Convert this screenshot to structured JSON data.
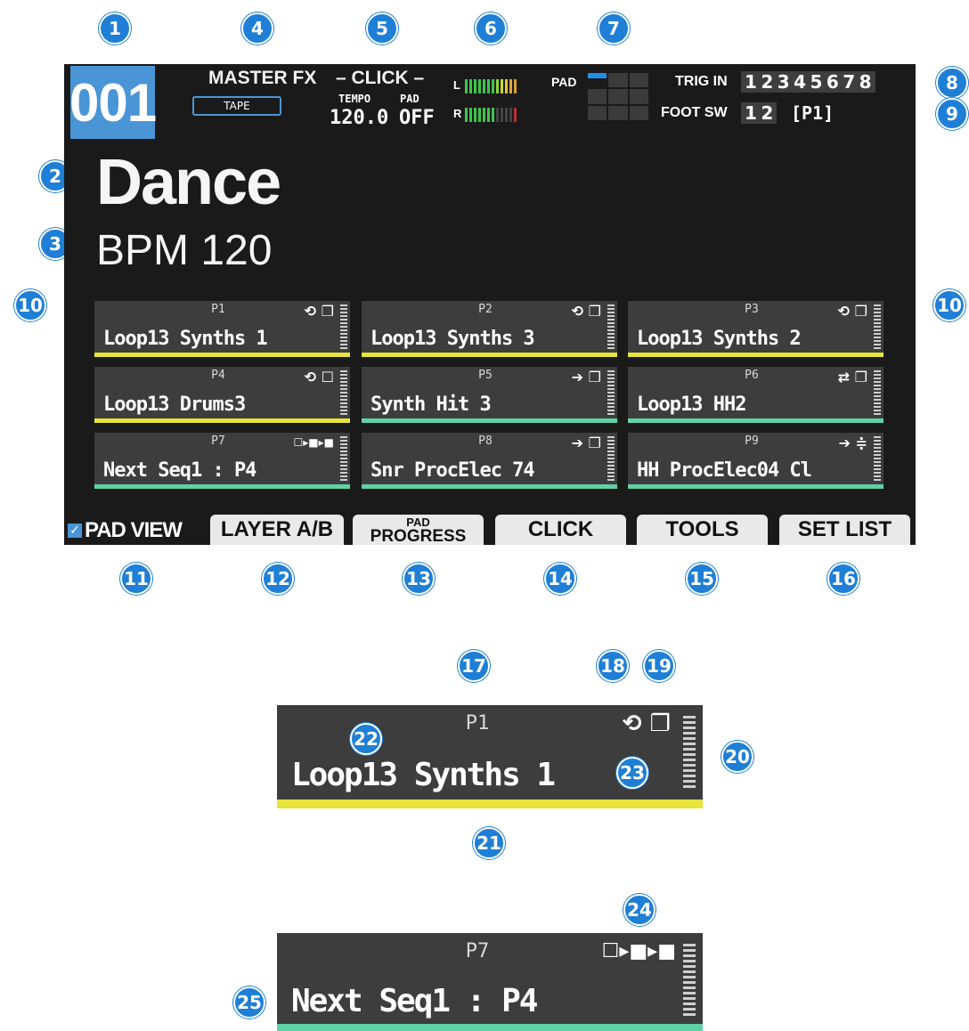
{
  "badges": [
    "1",
    "2",
    "3",
    "4",
    "5",
    "6",
    "7",
    "8",
    "9",
    "10",
    "10",
    "11",
    "12",
    "13",
    "14",
    "15",
    "16",
    "17",
    "18",
    "19",
    "20",
    "21",
    "22",
    "23",
    "24",
    "25"
  ],
  "top": {
    "kit_number": "001",
    "master_fx_label": "MASTER FX",
    "master_fx_value": "TAPE",
    "click_label": "– CLICK –",
    "tempo_label": "TEMPO",
    "tempo_value": "120.0",
    "pad_label": "PAD",
    "pad_value": "OFF",
    "meter_l": "L",
    "meter_r": "R",
    "pad_view_label": "PAD",
    "trig_in_label": "TRIG IN",
    "trig_in_values": [
      "1",
      "2",
      "3",
      "4",
      "5",
      "6",
      "7",
      "8"
    ],
    "foot_sw_label": "FOOT SW",
    "foot_sw_values": [
      "1",
      "2"
    ],
    "foot_sw_assign": "[P1]"
  },
  "kit": {
    "name": "Dance",
    "bpm": "BPM 120"
  },
  "pads": [
    {
      "id": "P1",
      "title": "Loop13 Synths 1",
      "icons": "⟲ ❐",
      "bar_color": "#e7e43a"
    },
    {
      "id": "P2",
      "title": "Loop13 Synths 3",
      "icons": "⟲ ❐",
      "bar_color": "#e7e43a"
    },
    {
      "id": "P3",
      "title": "Loop13 Synths 2",
      "icons": "⟲ ❐",
      "bar_color": "#e7e43a"
    },
    {
      "id": "P4",
      "title": "Loop13 Drums3",
      "icons": "⟲ ☐",
      "bar_color": "#e7e43a"
    },
    {
      "id": "P5",
      "title": "Synth Hit 3",
      "icons": "➔ ❐",
      "bar_color": "#5fd3a6"
    },
    {
      "id": "P6",
      "title": "Loop13 HH2",
      "icons": "⇄ ❐",
      "bar_color": "#5fd3a6"
    },
    {
      "id": "P7",
      "title": "Next Seq1 : P4",
      "icons": "☐▸■▸■",
      "bar_color": "#5fd3a6"
    },
    {
      "id": "P8",
      "title": "Snr ProcElec 74",
      "icons": "➔ ❐",
      "bar_color": "#5fd3a6"
    },
    {
      "id": "P9",
      "title": "HH ProcElec04 Cl",
      "icons": "➔ ≑",
      "bar_color": "#5fd3a6"
    }
  ],
  "tabs": {
    "pad_view": "PAD VIEW",
    "layer": "LAYER A/B",
    "pad_progress_1": "PAD",
    "pad_progress_2": "PROGRESS",
    "click": "CLICK",
    "tools": "TOOLS",
    "set_list": "SET LIST"
  },
  "detail1": {
    "id": "P1",
    "title": "Loop13 Synths 1",
    "icons": "⟲ ❐",
    "bar_color": "#e7e43a"
  },
  "detail2": {
    "id": "P7",
    "title": "Next Seq1 : P4",
    "icons": "☐▸■▸■",
    "bar_color": "#5fd3a6"
  },
  "colors": {
    "accent": "#4a95d6",
    "badge": "#1f7fd6",
    "yellow_bar": "#e7e43a",
    "green_bar": "#5fd3a6"
  }
}
